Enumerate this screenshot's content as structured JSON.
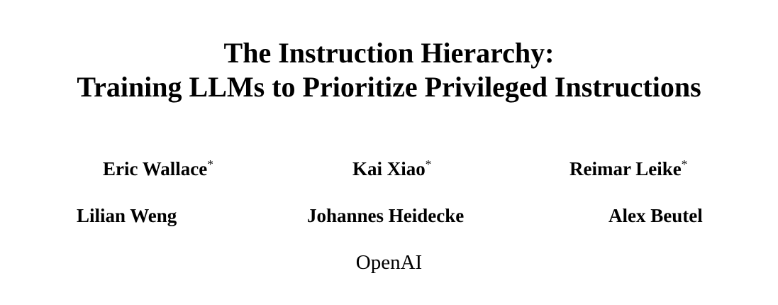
{
  "paper": {
    "title_line_1": "The Instruction Hierarchy:",
    "title_line_2": "Training LLMs to Prioritize Privileged Instructions",
    "authors": [
      {
        "name": "Eric Wallace",
        "mark": "*"
      },
      {
        "name": "Kai Xiao",
        "mark": "*"
      },
      {
        "name": "Reimar Leike",
        "mark": "*"
      },
      {
        "name": "Lilian Weng",
        "mark": ""
      },
      {
        "name": "Johannes Heidecke",
        "mark": ""
      },
      {
        "name": "Alex Beutel",
        "mark": ""
      }
    ],
    "affiliation": "OpenAI"
  }
}
